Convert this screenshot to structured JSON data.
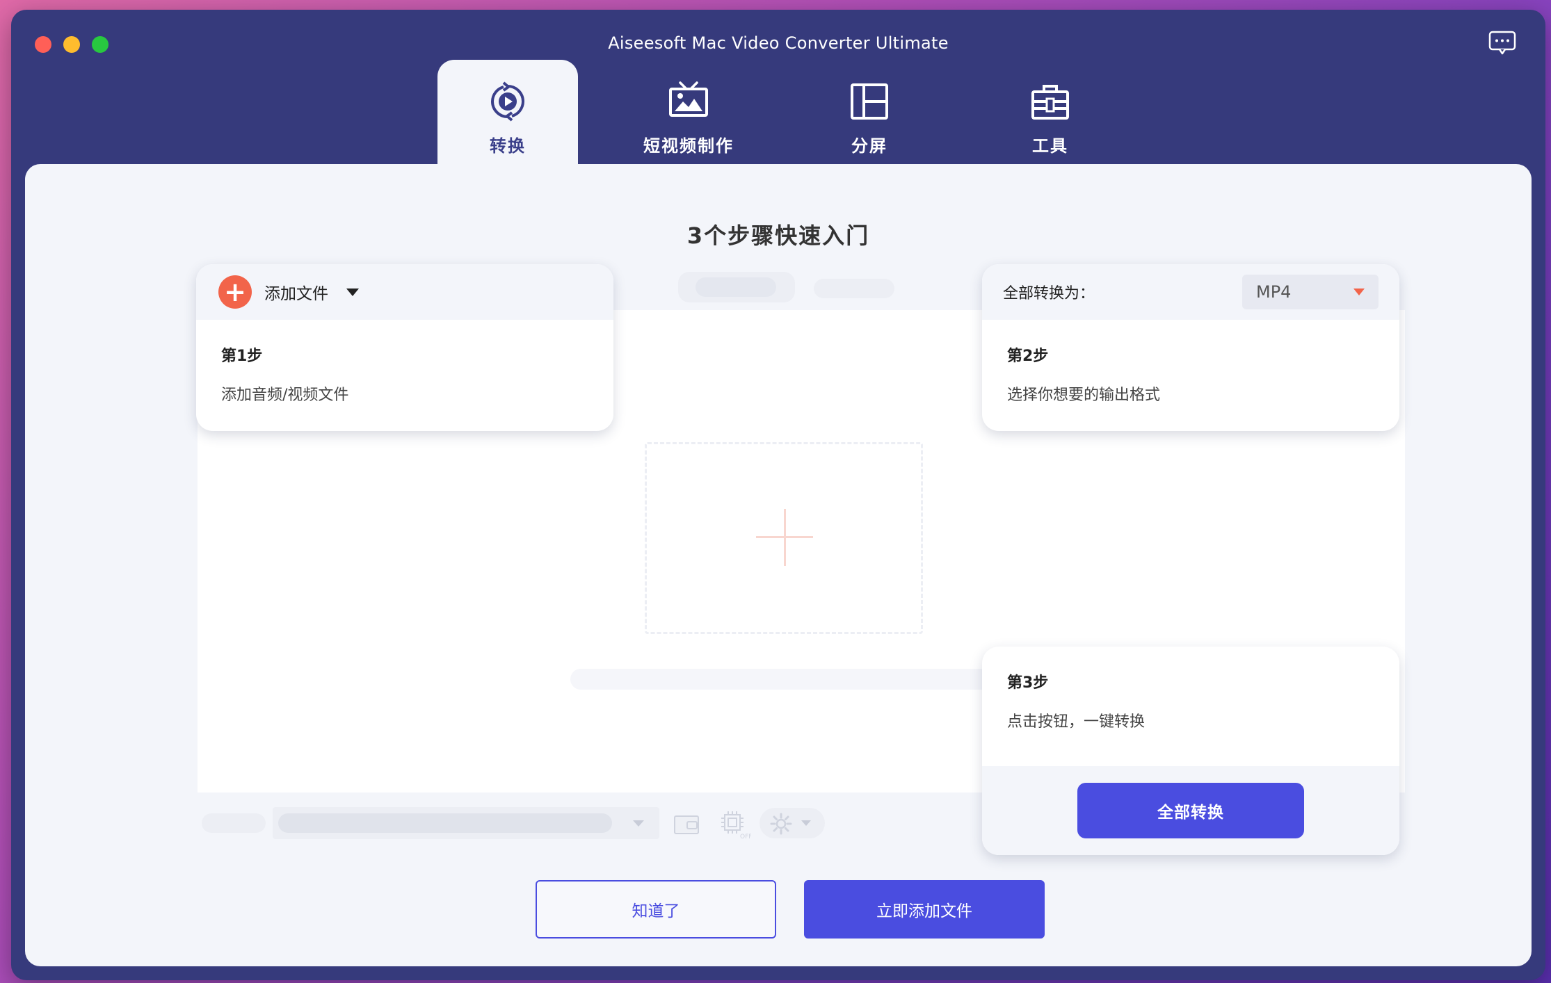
{
  "window": {
    "title": "Aiseesoft Mac Video Converter Ultimate"
  },
  "tabs": [
    {
      "label": "转换",
      "icon": "convert-icon",
      "active": true
    },
    {
      "label": "短视频制作",
      "icon": "mv-icon",
      "active": false
    },
    {
      "label": "分屏",
      "icon": "collage-icon",
      "active": false
    },
    {
      "label": "工具",
      "icon": "toolbox-icon",
      "active": false
    }
  ],
  "guide": {
    "heading": "3个步骤快速入门",
    "step1": {
      "add_label": "添加文件",
      "title": "第1步",
      "desc": "添加音频/视频文件"
    },
    "step2": {
      "convert_label": "全部转换为：",
      "format": "MP4",
      "title": "第2步",
      "desc": "选择你想要的输出格式"
    },
    "step3": {
      "title": "第3步",
      "desc": "点击按钮，一键转换",
      "button": "全部转换"
    }
  },
  "actions": {
    "got_it": "知道了",
    "add_now": "立即添加文件"
  },
  "colors": {
    "window_bg": "#363a7c",
    "accent": "#4a4de0",
    "add_orange": "#f2644a"
  }
}
